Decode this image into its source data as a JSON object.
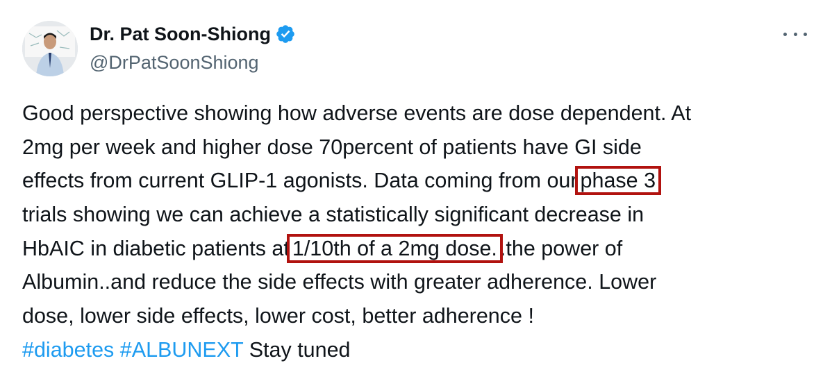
{
  "author": {
    "display_name": "Dr. Pat Soon-Shiong",
    "handle": "@DrPatSoonShiong",
    "verified_icon": "verified-badge-icon",
    "avatar": "profile-photo",
    "more_icon": "more-horizontal-icon"
  },
  "tweet": {
    "lines": [
      {
        "parts": [
          "Good perspective showing how adverse events are dose dependent. At"
        ]
      },
      {
        "parts": [
          "2mg per week and higher dose 70percent of patients have GI side"
        ]
      },
      {
        "parts": [
          "effects from current GLIP-1 agonists. Data coming from our",
          "phase 3",
          ""
        ]
      },
      {
        "parts": [
          "trials showing we can achieve a statistically significant decrease in"
        ]
      },
      {
        "parts": [
          "HbAIC in diabetic patients  at",
          "1/10th of a 2mg dose.",
          ".the power of"
        ]
      },
      {
        "parts": [
          "Albumin..and reduce the side effects with greater adherence. Lower"
        ]
      },
      {
        "parts": [
          "dose, lower side effects, lower cost, better adherence !"
        ]
      }
    ],
    "hashtags": [
      "#diabetes",
      "#ALBUNEXT"
    ],
    "trailing": "Stay tuned"
  },
  "colors": {
    "text": "#0f1419",
    "secondary": "#536471",
    "link": "#1d9bf0",
    "highlight_box": "#b1120f",
    "verified": "#1d9bf0"
  }
}
